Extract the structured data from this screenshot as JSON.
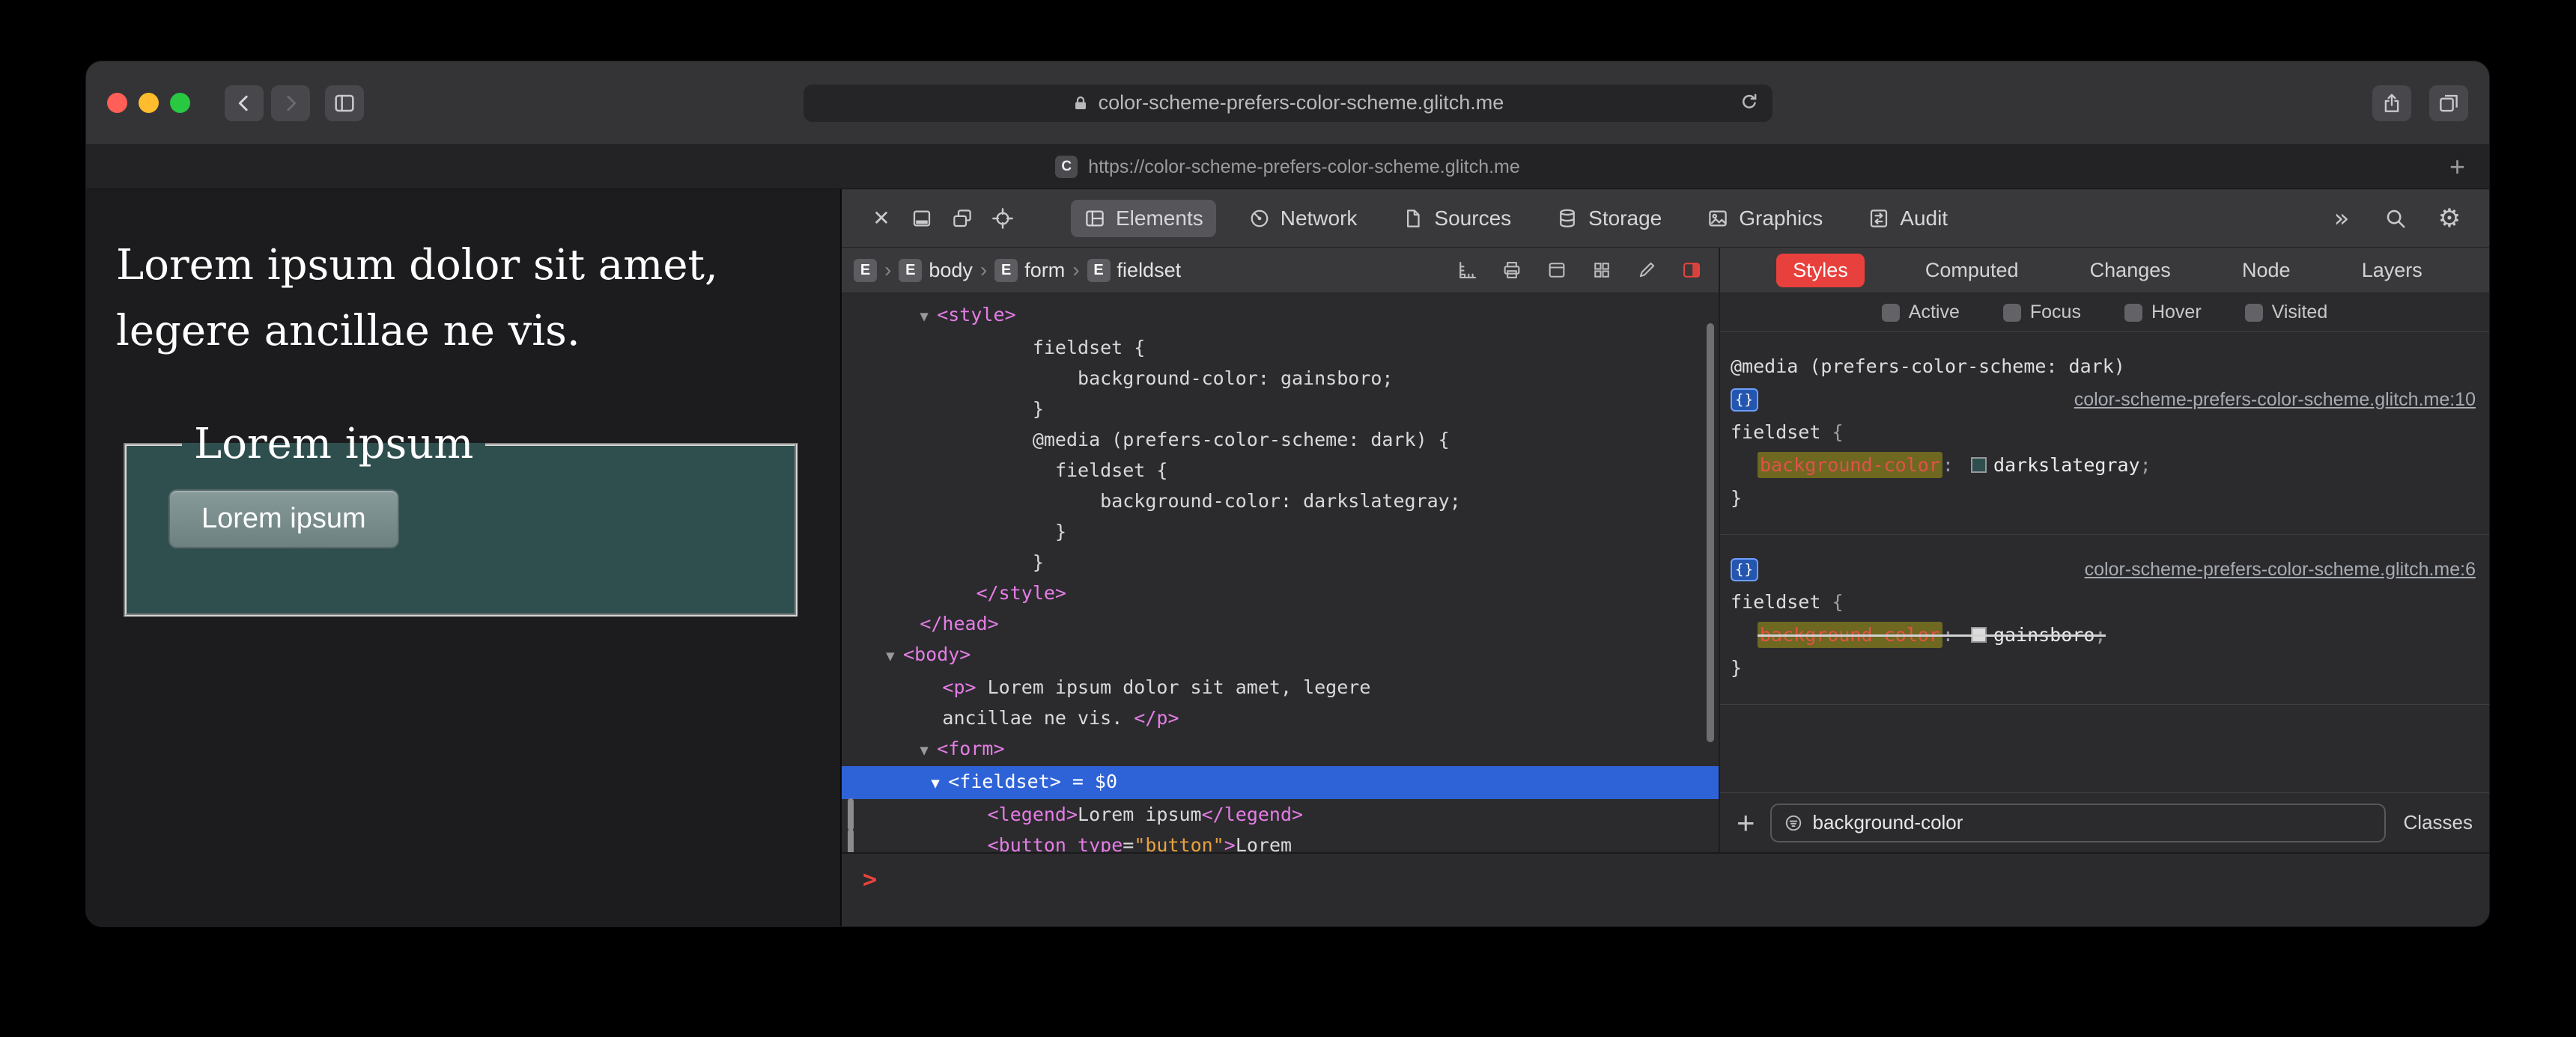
{
  "browser": {
    "address": "color-scheme-prefers-color-scheme.glitch.me",
    "tab": {
      "favicon_letter": "C",
      "url": "https://color-scheme-prefers-color-scheme.glitch.me"
    },
    "new_tab_label": "+"
  },
  "page": {
    "paragraph": "Lorem ipsum dolor sit amet, legere ancillae ne vis.",
    "fieldset": {
      "legend": "Lorem ipsum",
      "button": "Lorem ipsum",
      "background": "#2f4f4f"
    }
  },
  "devtools": {
    "toolbar": {
      "tabs": [
        {
          "label": "Elements",
          "selected": true
        },
        {
          "label": "Network",
          "selected": false
        },
        {
          "label": "Sources",
          "selected": false
        },
        {
          "label": "Storage",
          "selected": false
        },
        {
          "label": "Graphics",
          "selected": false
        },
        {
          "label": "Audit",
          "selected": false
        }
      ],
      "overflow_label": "»"
    },
    "breadcrumbs": [
      {
        "icon": "E",
        "label": ""
      },
      {
        "icon": "E",
        "label": "body"
      },
      {
        "icon": "E",
        "label": "form"
      },
      {
        "icon": "E",
        "label": "fieldset"
      }
    ],
    "dom_lines": [
      {
        "ind": 6,
        "segs": [
          [
            "tri",
            "▼ "
          ],
          [
            "tag",
            "<style>"
          ]
        ]
      },
      {
        "ind": 16,
        "segs": [
          [
            "css",
            "fieldset {"
          ]
        ]
      },
      {
        "ind": 20,
        "segs": [
          [
            "css",
            "background-color: gainsboro;"
          ]
        ]
      },
      {
        "ind": 16,
        "segs": [
          [
            "css",
            "}"
          ]
        ]
      },
      {
        "ind": 16,
        "segs": [
          [
            "css",
            "@media (prefers-color-scheme: dark) {"
          ]
        ]
      },
      {
        "ind": 18,
        "segs": [
          [
            "css",
            "fieldset {"
          ]
        ]
      },
      {
        "ind": 22,
        "segs": [
          [
            "css",
            "background-color: darkslategray;"
          ]
        ]
      },
      {
        "ind": 18,
        "segs": [
          [
            "css",
            "}"
          ]
        ]
      },
      {
        "ind": 16,
        "segs": [
          [
            "css",
            "}"
          ]
        ]
      },
      {
        "ind": 11,
        "segs": [
          [
            "tag",
            "</style>"
          ]
        ]
      },
      {
        "ind": 6,
        "segs": [
          [
            "tag",
            "</head>"
          ]
        ]
      },
      {
        "ind": 3,
        "segs": [
          [
            "tri",
            "▼ "
          ],
          [
            "tag",
            "<body>"
          ]
        ]
      },
      {
        "ind": 8,
        "segs": [
          [
            "tag",
            "<p>"
          ],
          [
            "text",
            " Lorem ipsum dolor sit amet, legere"
          ]
        ]
      },
      {
        "ind": 8,
        "segs": [
          [
            "text",
            "ancillae ne vis. "
          ],
          [
            "tag",
            "</p>"
          ]
        ]
      },
      {
        "ind": 6,
        "segs": [
          [
            "tri",
            "▼ "
          ],
          [
            "tag",
            "<form>"
          ]
        ]
      },
      {
        "ind": 7,
        "sel": true,
        "segs": [
          [
            "tri",
            "▼ "
          ],
          [
            "tag",
            "<fieldset>"
          ],
          [
            "text",
            " = $0"
          ]
        ]
      },
      {
        "ind": 12,
        "gutter": true,
        "segs": [
          [
            "tag",
            "<legend>"
          ],
          [
            "text",
            "Lorem ipsum"
          ],
          [
            "tag",
            "</legend>"
          ]
        ]
      },
      {
        "ind": 12,
        "gutter": true,
        "segs": [
          [
            "tag",
            "<button "
          ],
          [
            "attr",
            "type"
          ],
          [
            "text",
            "="
          ],
          [
            "val",
            "\"button\""
          ],
          [
            "tag",
            ">"
          ],
          [
            "text",
            "Lorem"
          ]
        ]
      }
    ],
    "console_prompt": ">",
    "styles": {
      "tabs": [
        {
          "label": "Styles",
          "selected": true
        },
        {
          "label": "Computed",
          "selected": false
        },
        {
          "label": "Changes",
          "selected": false
        },
        {
          "label": "Node",
          "selected": false
        },
        {
          "label": "Layers",
          "selected": false
        }
      ],
      "pseudo": [
        "Active",
        "Focus",
        "Hover",
        "Visited"
      ],
      "rule_icon": "{}",
      "rules": [
        {
          "media": "@media (prefers-color-scheme: dark)",
          "link": "color-scheme-prefers-color-scheme.glitch.me:10",
          "selector": "fieldset",
          "open": " {",
          "property": "background-color",
          "colon": ": ",
          "value": "darkslategray",
          "semi": ";",
          "close": "}",
          "swatch": "#2f4f4f",
          "struck": false
        },
        {
          "media": "",
          "link": "color-scheme-prefers-color-scheme.glitch.me:6",
          "selector": "fieldset",
          "open": " {",
          "property": "background-color",
          "colon": ": ",
          "value": "gainsboro",
          "semi": ";",
          "close": "}",
          "swatch": "#dcdcdc",
          "struck": true
        }
      ],
      "filter_value": "background-color",
      "classes_label": "Classes",
      "add_label": "+"
    }
  }
}
